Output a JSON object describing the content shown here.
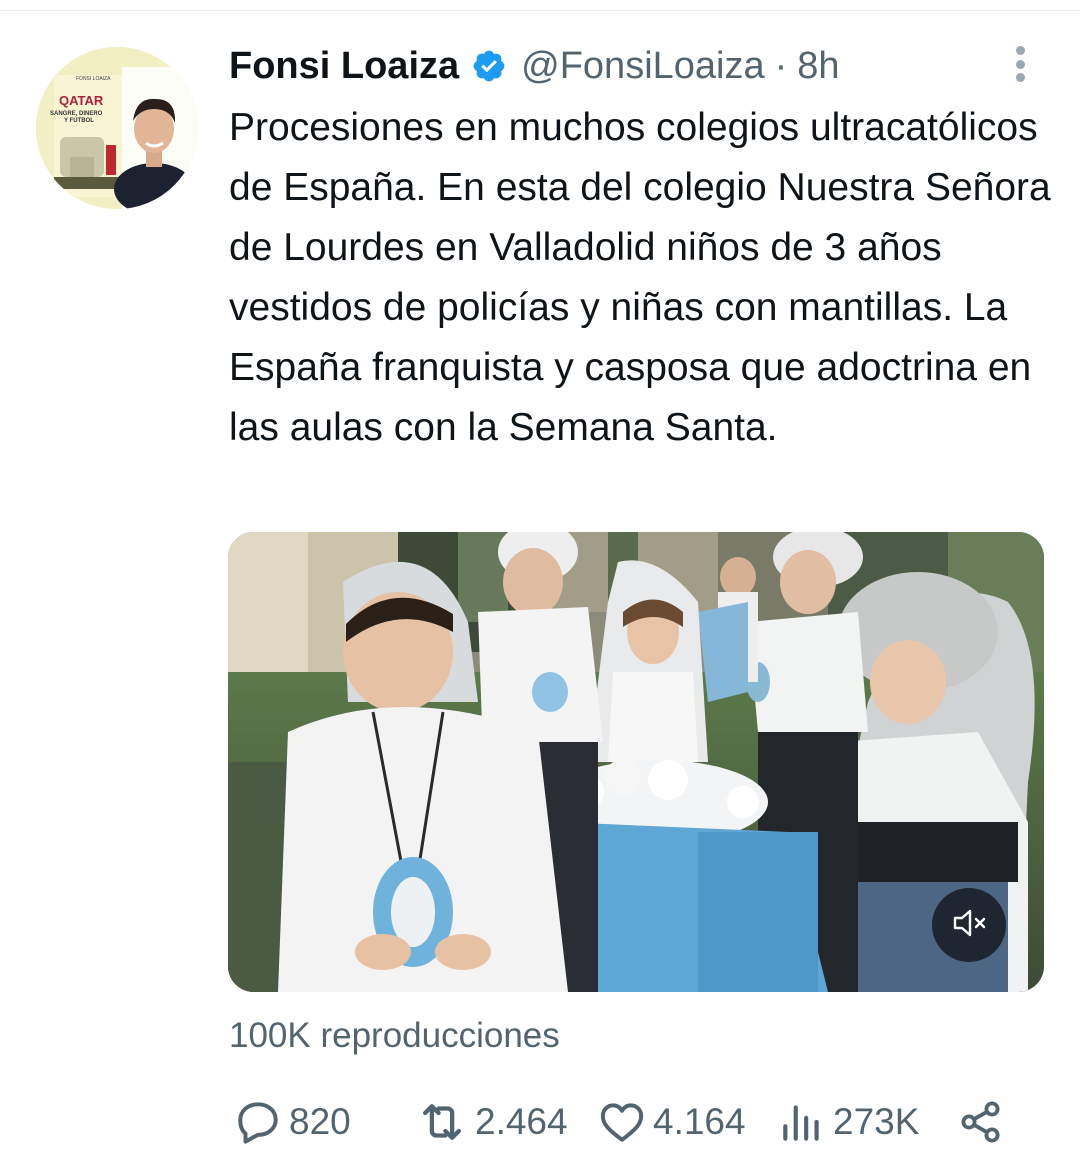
{
  "tweet": {
    "display_name": "Fonsi Loaiza",
    "handle": "@FonsiLoaiza",
    "separator": "·",
    "time": "8h",
    "avatar_book": {
      "author": "FONSI LOAIZA",
      "title": "QATAR",
      "subtitle_line1": "SANGRE, DINERO",
      "subtitle_line2": "Y FÚTBOL"
    },
    "text": "Procesiones en muchos colegios ultracatólicos de España. En esta del colegio Nuestra Señora de Lourdes en Valladolid niños de 3 años vestidos de policías y niñas con mantillas. La España franquista y casposa que adoctrina en las aulas con la Semana Santa.",
    "views": "100K reproducciones",
    "actions": {
      "replies": "820",
      "retweets": "2.464",
      "likes": "4.164",
      "impressions": "273K"
    }
  },
  "icons": {
    "verified": "verified-badge-icon",
    "more": "more-vertical-icon",
    "mute": "volume-muted-icon",
    "reply": "reply-icon",
    "retweet": "retweet-icon",
    "like": "heart-icon",
    "analytics": "analytics-icon",
    "share": "share-icon"
  },
  "colors": {
    "text": "#0f1419",
    "secondary": "#536471",
    "verified": "#1d9bf0",
    "divider": "#e6ecf0"
  }
}
